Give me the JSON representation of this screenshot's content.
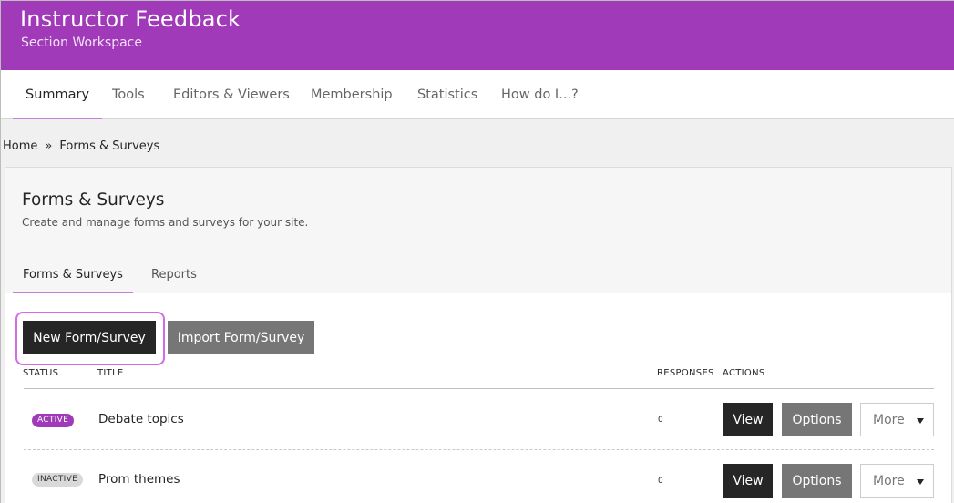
{
  "header": {
    "title": "Instructor Feedback",
    "subtitle": "Section Workspace",
    "accent_color": "#a13ab8"
  },
  "nav": {
    "tabs": [
      {
        "label": "Summary",
        "active": true
      },
      {
        "label": "Tools"
      },
      {
        "label": "Editors & Viewers"
      },
      {
        "label": "Membership"
      },
      {
        "label": "Statistics"
      },
      {
        "label": "How do I...?"
      }
    ]
  },
  "breadcrumb": {
    "home": "Home",
    "separator": "»",
    "current": "Forms & Surveys"
  },
  "page": {
    "title": "Forms & Surveys",
    "description": "Create and manage forms and surveys for your site."
  },
  "subtabs": [
    {
      "label": "Forms & Surveys",
      "active": true
    },
    {
      "label": "Reports"
    }
  ],
  "actions": {
    "new_label": "New Form/Survey",
    "import_label": "Import Form/Survey"
  },
  "table": {
    "columns": [
      "STATUS",
      "TITLE",
      "RESPONSES",
      "ACTIONS"
    ],
    "rows": [
      {
        "status": "ACTIVE",
        "title": "Debate topics",
        "responses": "0",
        "view": "View",
        "options": "Options",
        "more": "More"
      },
      {
        "status": "INACTIVE",
        "title": "Prom themes",
        "responses": "0",
        "view": "View",
        "options": "Options",
        "more": "More"
      }
    ]
  }
}
